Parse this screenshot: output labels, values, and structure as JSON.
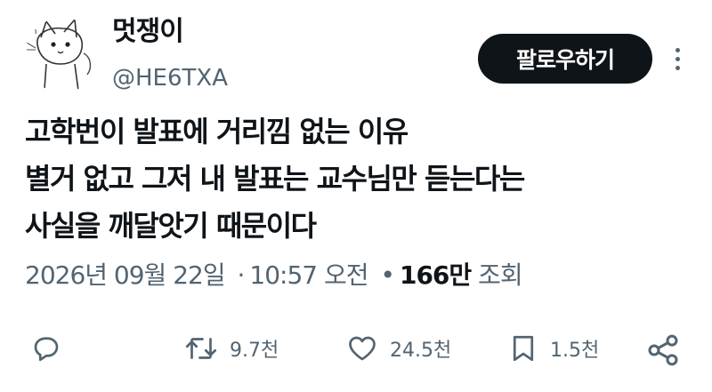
{
  "author": {
    "display_name": "멋쟁이",
    "handle": "@HE6TXA"
  },
  "follow_button": {
    "label": "팔로우하기"
  },
  "more_icon": "more-horizontal-icon",
  "tweet": {
    "lines": [
      "고학번이 발표에 거리낌 없는 이유",
      "별거 없고 그저 내 발표는 교수님만 듣는다는",
      "사실을 깨달앗기 때문이다"
    ]
  },
  "meta": {
    "date": "2026년 09월 22일",
    "time": "10:57 오전",
    "views_count": "166만",
    "views_label": "조회",
    "separator": "·",
    "bullet": "•"
  },
  "actions": {
    "reply": {
      "icon": "reply-icon"
    },
    "retweet": {
      "icon": "retweet-icon",
      "count": "9.7천"
    },
    "like": {
      "icon": "heart-icon",
      "count": "24.5천"
    },
    "bookmark": {
      "icon": "bookmark-icon",
      "count": "1.5천"
    },
    "share": {
      "icon": "share-icon"
    }
  },
  "colors": {
    "text_primary": "#0f1419",
    "text_secondary": "#536471",
    "button_bg": "#0f1419",
    "button_text": "#ffffff"
  }
}
